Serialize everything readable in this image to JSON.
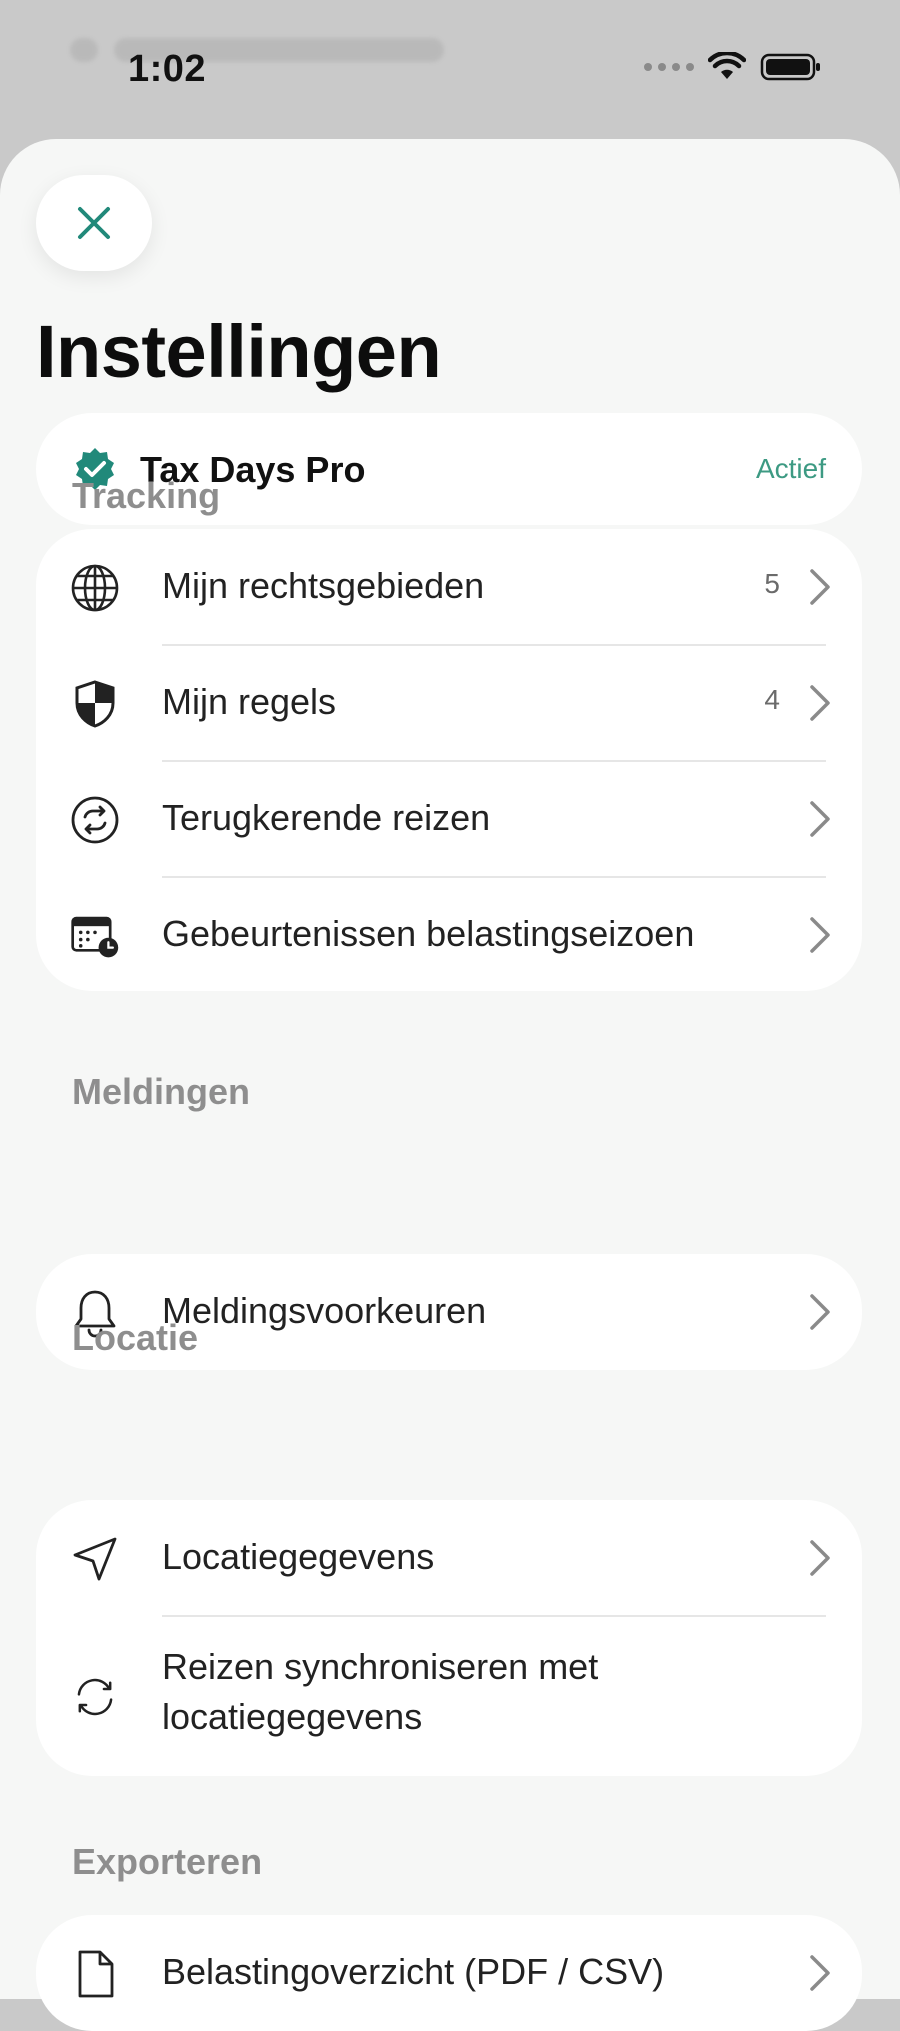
{
  "status_bar": {
    "time": "1:02"
  },
  "sheet": {
    "title": "Instellingen",
    "subscription": {
      "name": "Tax Days Pro",
      "status": "Actief"
    },
    "sections": [
      {
        "label": "Tracking",
        "items": [
          {
            "label": "Mijn rechtsgebieden",
            "count": "5",
            "icon": "globe-icon"
          },
          {
            "label": "Mijn regels",
            "count": "4",
            "icon": "shield-icon"
          },
          {
            "label": "Terugkerende reizen",
            "icon": "repeat-icon"
          },
          {
            "label": "Gebeurtenissen belastingseizoen",
            "icon": "calendar-clock-icon"
          }
        ]
      },
      {
        "label": "Meldingen",
        "items": [
          {
            "label": "Meldingsvoorkeuren",
            "icon": "bell-icon"
          }
        ]
      },
      {
        "label": "Locatie",
        "items": [
          {
            "label": "Locatiegegevens",
            "icon": "location-arrow-icon"
          },
          {
            "label": "Reizen synchroniseren met locatiegegevens",
            "icon": "sync-icon"
          }
        ]
      },
      {
        "label": "Exporteren",
        "items": [
          {
            "label": "Belastingoverzicht (PDF / CSV)",
            "icon": "document-icon"
          }
        ]
      }
    ]
  },
  "colors": {
    "accent": "#21897a",
    "active": "#3d9a83",
    "section_label": "#8e8e8e",
    "sheet_bg": "#f6f7f6"
  }
}
